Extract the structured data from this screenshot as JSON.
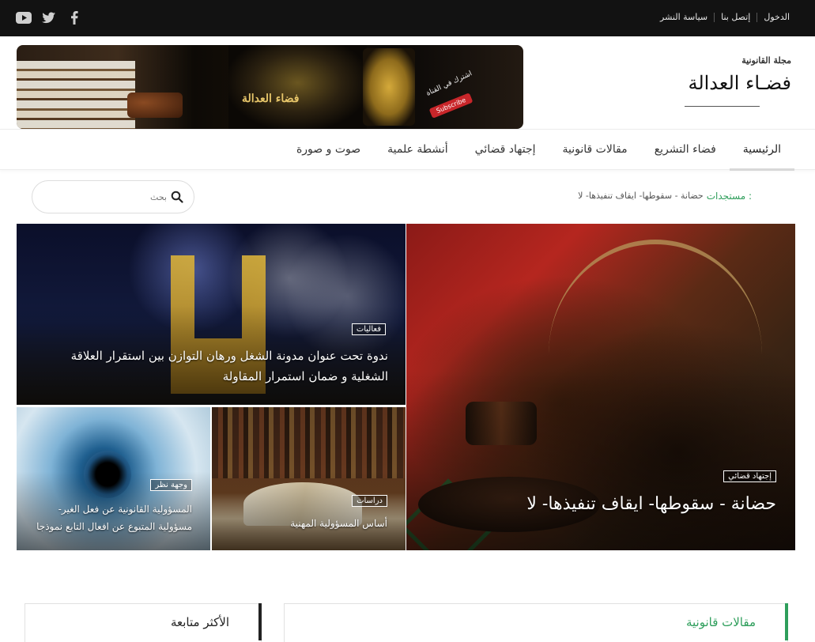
{
  "topbar": {
    "links": [
      "الدخول",
      "إتصل بنا",
      "سياسة النشر"
    ],
    "social_icons": [
      "youtube-icon",
      "twitter-icon",
      "facebook-icon"
    ]
  },
  "header": {
    "banner": {
      "stage_title": "فضاء العدالة",
      "promo_text": "اشترك في القناة",
      "subscribe_label": "Subscribe"
    },
    "logo": {
      "brand": "مجلة القانونية",
      "name": "فضـاء العدالة"
    }
  },
  "nav": {
    "items": [
      "الرئيسية",
      "فضاء التشريع",
      "مقالات قانونية",
      "إجتهاد قضائي",
      "أنشطة علمية",
      "صوت و صورة"
    ],
    "active_index": 0
  },
  "ticker": {
    "label": "مستجدات :",
    "text": "حضانة - سقوطها- ايقاف تنفيذها- لا"
  },
  "search": {
    "placeholder": "بحث"
  },
  "featured": {
    "main": {
      "category": "إجتهاد قضائي",
      "title": "حضانة - سقوطها- ايقاف تنفيذها- لا"
    },
    "top": {
      "category": "فعاليات",
      "title": "ندوة تحت عنوان مدونة الشغل ورهان التوازن بين استقرار العلاقة الشغلية و ضمان استمرار المقاولة"
    },
    "bottom_right": {
      "category": "دراسات",
      "title": "أساس المسؤولية المهنية"
    },
    "bottom_left": {
      "category": "وجهة نظر",
      "title": "المسؤولية القانونية عن فعل الغير- مسؤولية المتبوع عن افعال التابع نموذجا"
    }
  },
  "sections": {
    "articles_title": "مقالات قانونية",
    "most_followed_title": "الأكثر متابعة"
  },
  "colors": {
    "topbar_bg": "#121212",
    "accent_green": "#2e9e5b"
  }
}
